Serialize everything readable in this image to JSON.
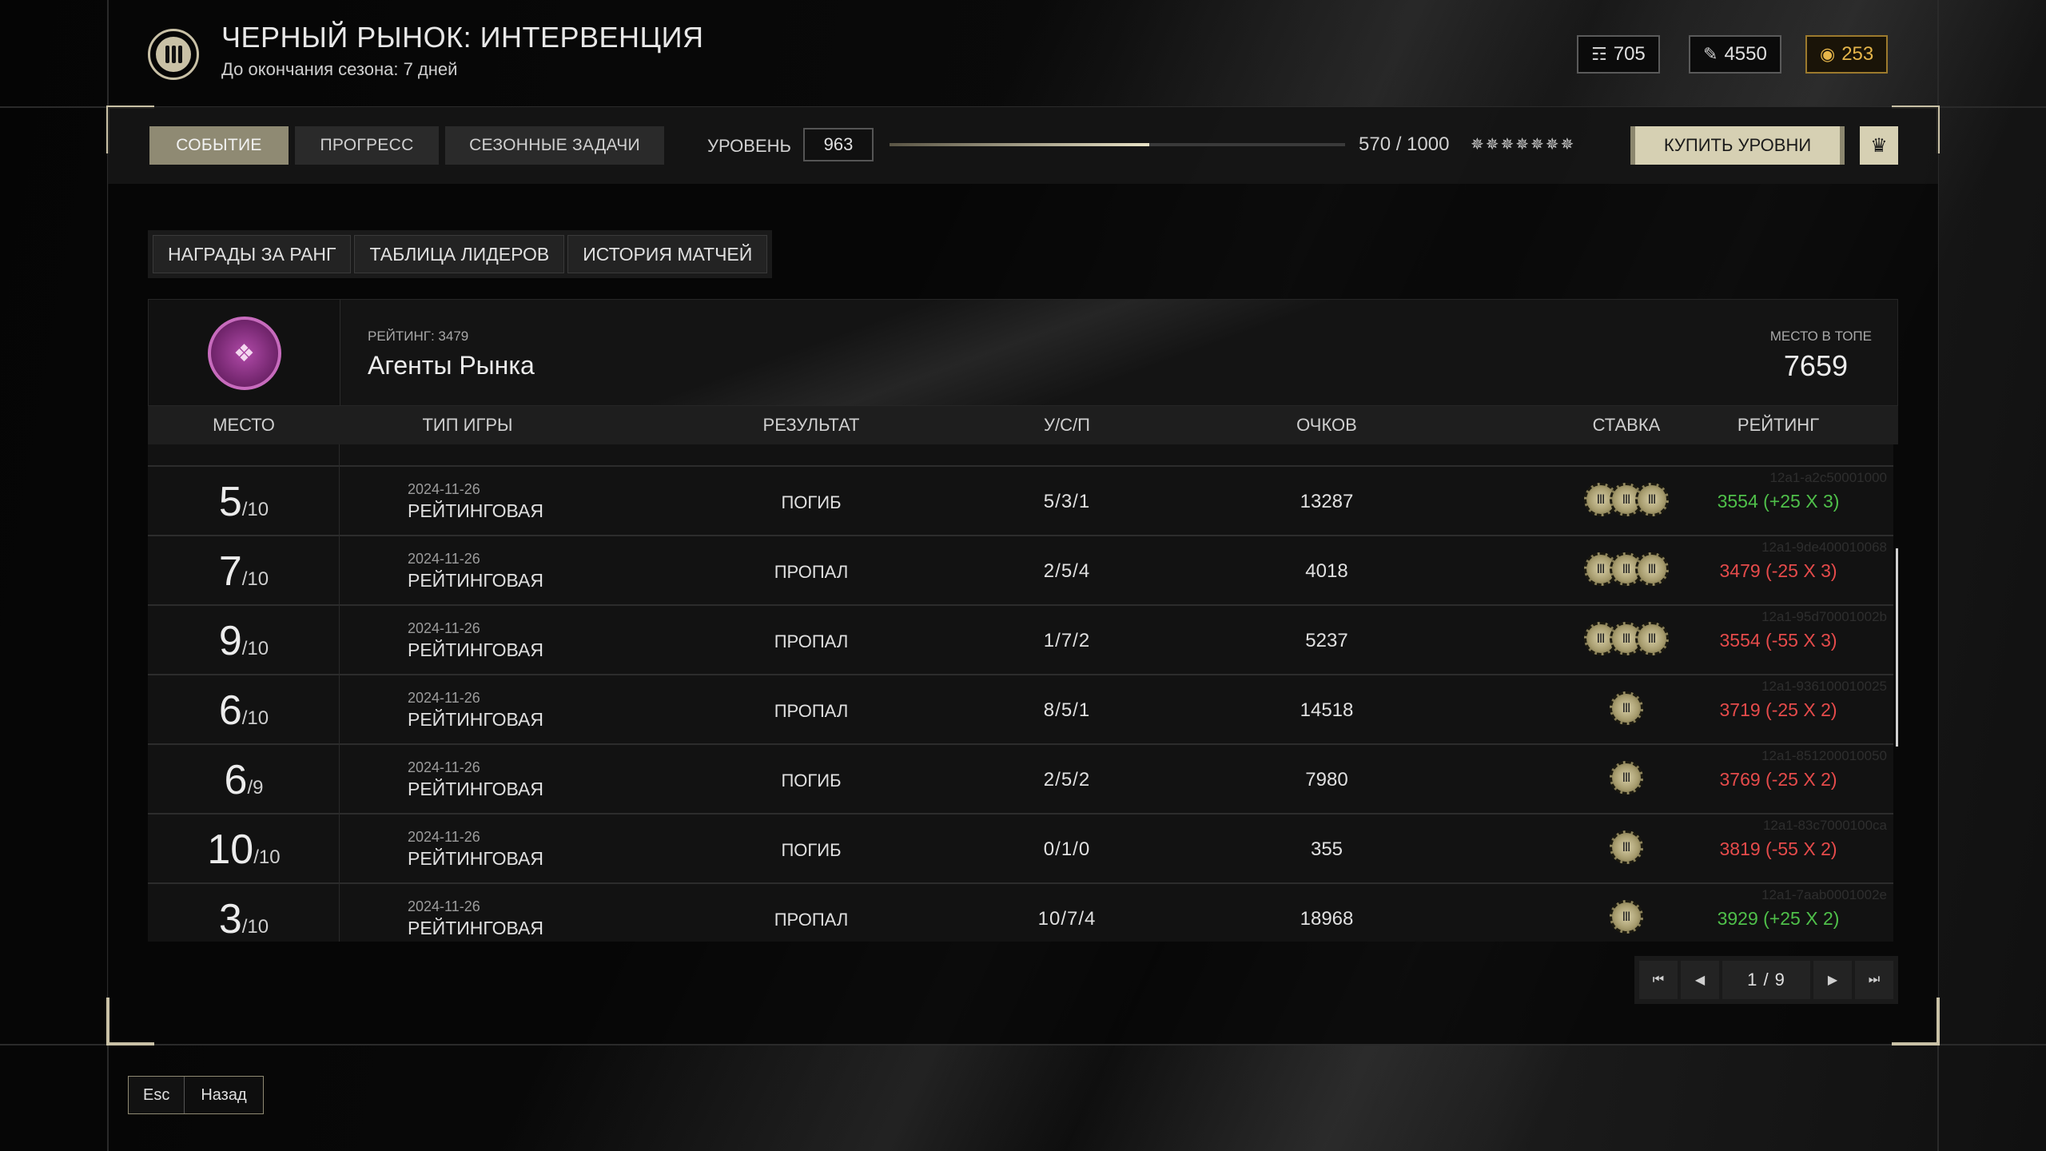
{
  "header": {
    "title": "ЧЕРНЫЙ РЫНОК: ИНТЕРВЕНЦИЯ",
    "subtitle": "До окончания сезона: 7 дней"
  },
  "currencies": [
    {
      "icon": "tokens-icon",
      "value": "705"
    },
    {
      "icon": "ticket-icon",
      "value": "4550"
    },
    {
      "icon": "coin-icon",
      "value": "253",
      "color": "#e5b54a"
    }
  ],
  "topbar": {
    "tabs": [
      {
        "label": "СОБЫТИЕ",
        "active": true
      },
      {
        "label": "ПРОГРЕСС",
        "active": false
      },
      {
        "label": "СЕЗОННЫЕ ЗАДАЧИ",
        "active": false
      }
    ],
    "level_label": "УРОВЕНЬ",
    "level_value": "963",
    "progress_text": "570 / 1000",
    "progress_fraction": 0.57,
    "buy_label": "КУПИТЬ УРОВНИ"
  },
  "subtabs": [
    "НАГРАДЫ ЗА РАНГ",
    "ТАБЛИЦА ЛИДЕРОВ",
    "ИСТОРИЯ МАТЧЕЙ"
  ],
  "rating_card": {
    "rating_small": "РЕЙТИНГ: 3479",
    "name": "Агенты Рынка",
    "rank_small": "МЕСТО В ТОПЕ",
    "rank_value": "7659"
  },
  "table": {
    "headers": [
      "МЕСТО",
      "ТИП ИГРЫ",
      "РЕЗУЛЬТАТ",
      "У/С/П",
      "ОЧКОВ",
      "СТАВКА",
      "РЕЙТИНГ"
    ],
    "rows": [
      {
        "place": "5",
        "of": "/10",
        "date": "2024-11-26",
        "type": "РЕЙТИНГОВАЯ",
        "result": "ПОГИБ",
        "kda": "5/3/1",
        "score": "13287",
        "chips": 3,
        "rating": "3554 (+25 X 3)",
        "trend": "up",
        "id": "12a1-a2c50001000"
      },
      {
        "place": "7",
        "of": "/10",
        "date": "2024-11-26",
        "type": "РЕЙТИНГОВАЯ",
        "result": "ПРОПАЛ",
        "kda": "2/5/4",
        "score": "4018",
        "chips": 3,
        "rating": "3479 (-25 X 3)",
        "trend": "down",
        "id": "12a1-9de400010068"
      },
      {
        "place": "9",
        "of": "/10",
        "date": "2024-11-26",
        "type": "РЕЙТИНГОВАЯ",
        "result": "ПРОПАЛ",
        "kda": "1/7/2",
        "score": "5237",
        "chips": 3,
        "rating": "3554 (-55 X 3)",
        "trend": "down",
        "id": "12a1-95d70001002b"
      },
      {
        "place": "6",
        "of": "/10",
        "date": "2024-11-26",
        "type": "РЕЙТИНГОВАЯ",
        "result": "ПРОПАЛ",
        "kda": "8/5/1",
        "score": "14518",
        "chips": 1,
        "rating": "3719 (-25 X 2)",
        "trend": "down",
        "id": "12a1-936100010025"
      },
      {
        "place": "6",
        "of": "/9",
        "date": "2024-11-26",
        "type": "РЕЙТИНГОВАЯ",
        "result": "ПОГИБ",
        "kda": "2/5/2",
        "score": "7980",
        "chips": 1,
        "rating": "3769 (-25 X 2)",
        "trend": "down",
        "id": "12a1-851200010050"
      },
      {
        "place": "10",
        "of": "/10",
        "date": "2024-11-26",
        "type": "РЕЙТИНГОВАЯ",
        "result": "ПОГИБ",
        "kda": "0/1/0",
        "score": "355",
        "chips": 1,
        "rating": "3819 (-55 X 2)",
        "trend": "down",
        "id": "12a1-83c7000100ca"
      },
      {
        "place": "3",
        "of": "/10",
        "date": "2024-11-26",
        "type": "РЕЙТИНГОВАЯ",
        "result": "ПРОПАЛ",
        "kda": "10/7/4",
        "score": "18968",
        "chips": 1,
        "rating": "3929 (+25 X 2)",
        "trend": "up",
        "id": "12a1-7aab0001002e"
      }
    ]
  },
  "pager": {
    "text": "1 / 9"
  },
  "footer": {
    "key": "Esc",
    "label": "Назад"
  },
  "colors": {
    "accent": "#c9c1a6",
    "positive": "#4fc04a",
    "negative": "#e64b4b"
  }
}
